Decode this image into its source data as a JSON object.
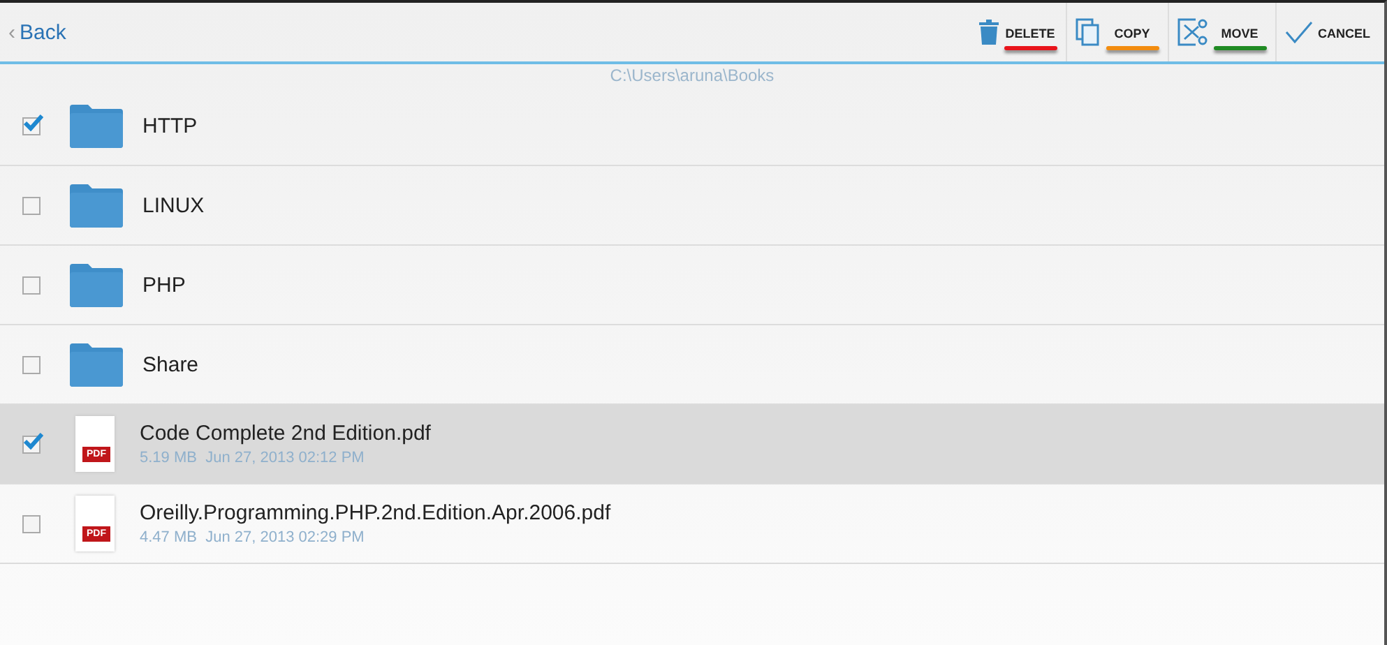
{
  "toolbar": {
    "back": {
      "chevron": "‹",
      "label": "Back"
    },
    "actions": [
      {
        "kind": "delete",
        "label": "DELETE",
        "color": "#e8141b"
      },
      {
        "kind": "copy",
        "label": "COPY",
        "color": "#f28c0f"
      },
      {
        "kind": "move",
        "label": "MOVE",
        "color": "#1f8a23"
      },
      {
        "kind": "cancel",
        "label": "CANCEL"
      }
    ]
  },
  "path": "C:\\Users\\aruna\\Books",
  "items": [
    {
      "kind": "folder",
      "name": "HTTP",
      "checked": true,
      "highlighted": false
    },
    {
      "kind": "folder",
      "name": "LINUX",
      "checked": false,
      "highlighted": false
    },
    {
      "kind": "folder",
      "name": "PHP",
      "checked": false,
      "highlighted": false
    },
    {
      "kind": "folder",
      "name": "Share",
      "checked": false,
      "highlighted": false
    },
    {
      "kind": "pdf",
      "name": "Code Complete 2nd Edition.pdf",
      "icon_label": "PDF",
      "size": "5.19 MB",
      "date": "Jun 27, 2013 02:12 PM",
      "checked": true,
      "highlighted": true
    },
    {
      "kind": "pdf",
      "name": "Oreilly.Programming.PHP.2nd.Edition.Apr.2006.pdf",
      "icon_label": "PDF",
      "size": "4.47 MB",
      "date": "Jun 27, 2013 02:29 PM",
      "checked": false,
      "highlighted": false
    }
  ]
}
